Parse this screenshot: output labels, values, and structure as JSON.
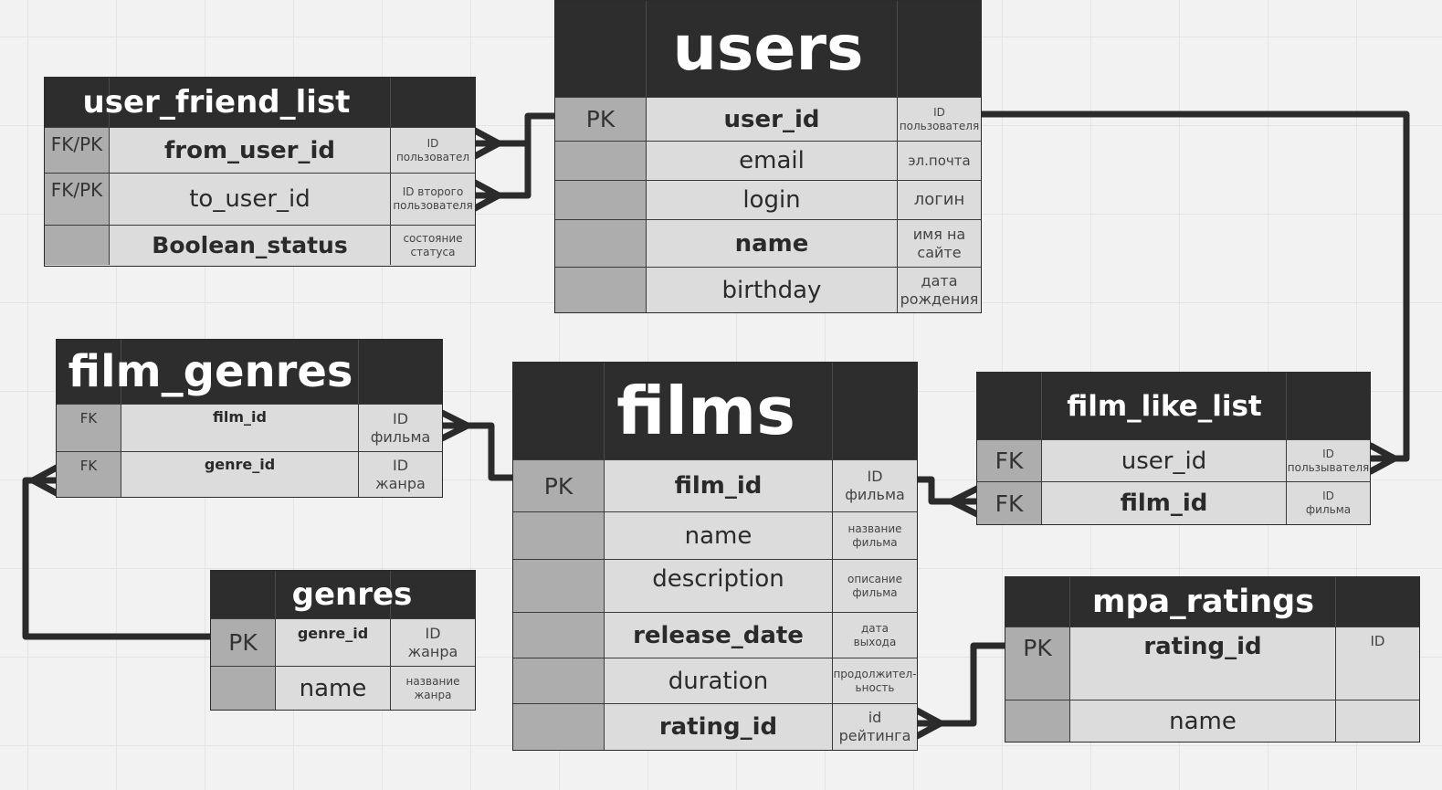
{
  "tables": {
    "user_friend_list": {
      "title": "user_friend_list",
      "rows": [
        {
          "key": "FK/PK",
          "name": "from_user_id",
          "desc": "ID пользовател"
        },
        {
          "key": "FK/PK",
          "name": "to_user_id",
          "desc": "ID второго пользователя"
        },
        {
          "key": "",
          "name": "Boolean_status",
          "desc": "состояние статуса"
        }
      ]
    },
    "users": {
      "title": "users",
      "rows": [
        {
          "key": "PK",
          "name": "user_id",
          "desc": "ID пользователя"
        },
        {
          "key": "",
          "name": "email",
          "desc": "эл.почта"
        },
        {
          "key": "",
          "name": "login",
          "desc": "логин"
        },
        {
          "key": "",
          "name": "name",
          "desc": "имя на сайте"
        },
        {
          "key": "",
          "name": "birthday",
          "desc": "дата рождения"
        }
      ]
    },
    "film_genres": {
      "title": "film_genres",
      "rows": [
        {
          "key": "FK",
          "name": "film_id",
          "desc": "ID фильма"
        },
        {
          "key": "FK",
          "name": "genre_id",
          "desc": "ID жанра"
        }
      ]
    },
    "films": {
      "title": "films",
      "rows": [
        {
          "key": "PK",
          "name": "film_id",
          "desc": "ID фильма"
        },
        {
          "key": "",
          "name": "name",
          "desc": "название фильма"
        },
        {
          "key": "",
          "name": "description",
          "desc": "описание фильма"
        },
        {
          "key": "",
          "name": "release_date",
          "desc": "дата выхода"
        },
        {
          "key": "",
          "name": "duration",
          "desc": "продолжител-ьность"
        },
        {
          "key": "",
          "name": "rating_id",
          "desc": "id рейтинга"
        }
      ]
    },
    "film_like_list": {
      "title": "film_like_list",
      "rows": [
        {
          "key": "FK",
          "name": "user_id",
          "desc": "ID пользывателя"
        },
        {
          "key": "FK",
          "name": "film_id",
          "desc": "ID фильма"
        }
      ]
    },
    "genres": {
      "title": "genres",
      "rows": [
        {
          "key": "PK",
          "name": "genre_id",
          "desc": "ID жанра"
        },
        {
          "key": "",
          "name": "name",
          "desc": "название жанра"
        }
      ]
    },
    "mpa_ratings": {
      "title": "mpa_ratings",
      "rows": [
        {
          "key": "PK",
          "name": "rating_id",
          "desc": "ID"
        },
        {
          "key": "",
          "name": "name",
          "desc": ""
        }
      ]
    }
  },
  "colors": {
    "header_bg": "#2d2d2d",
    "row_bg": "#dcdcdc",
    "key_col_bg": "#adadad",
    "connector": "#2b2b2b"
  }
}
